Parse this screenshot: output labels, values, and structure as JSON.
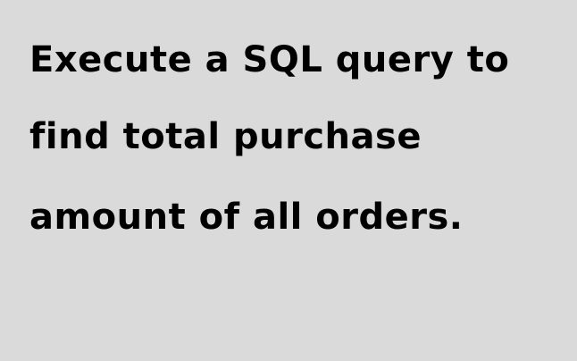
{
  "slide": {
    "lines": [
      "Execute a SQL query to",
      "find total purchase",
      "amount of all orders."
    ]
  }
}
